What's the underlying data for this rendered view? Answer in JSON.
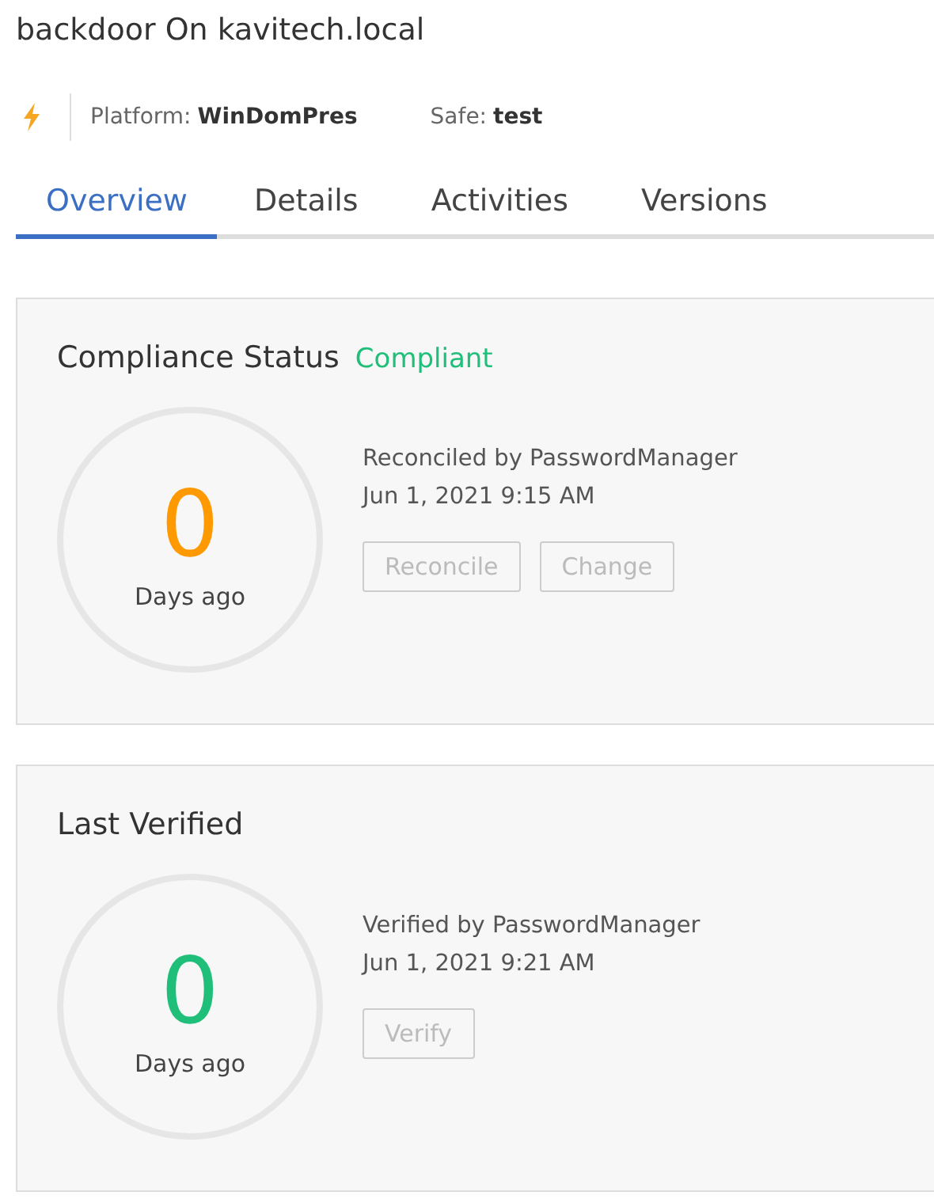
{
  "title": "backdoor On kavitech.local",
  "meta": {
    "platform_label": "Platform:",
    "platform": "WinDomPres",
    "safe_label": "Safe:",
    "safe": "test"
  },
  "tabs": [
    {
      "label": "Overview",
      "selected": true
    },
    {
      "label": "Details",
      "selected": false
    },
    {
      "label": "Activities",
      "selected": false
    },
    {
      "label": "Versions",
      "selected": false
    }
  ],
  "cards": [
    {
      "title": "Compliance Status",
      "status": "Compliant",
      "count": "0",
      "color": "#ff9900",
      "unit": "Days ago",
      "by": "Reconciled by PasswordManager",
      "date": "Jun 1, 2021 9:15 AM",
      "buttons": [
        {
          "label": "Reconcile",
          "disabled": true
        },
        {
          "label": "Change",
          "disabled": true
        }
      ]
    },
    {
      "title": "Last Verified",
      "count": "0",
      "color": "#1fbf7a",
      "unit": "Days ago",
      "by": "Verified by PasswordManager",
      "date": "Jun 1, 2021 9:21 AM",
      "buttons": [
        {
          "label": "Verify",
          "disabled": true
        }
      ]
    }
  ]
}
